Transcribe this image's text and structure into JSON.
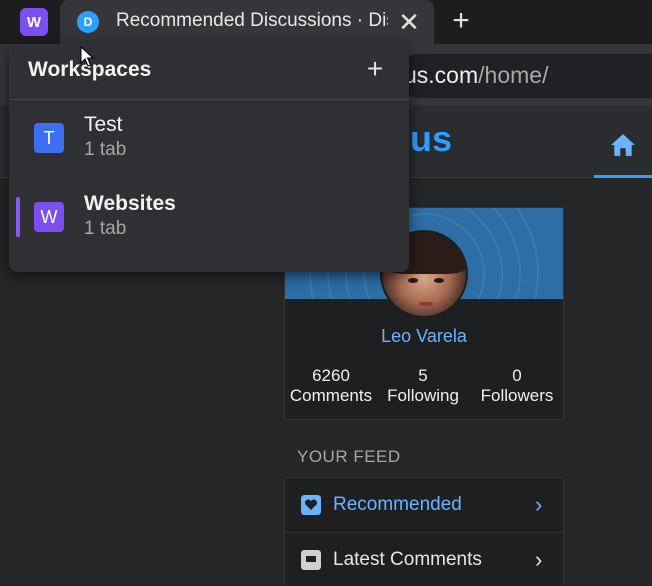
{
  "tabstrip": {
    "workspace_button_label": "W",
    "active_tab": {
      "favicon_letter": "D",
      "title": "Recommended Discussions · Disqus"
    },
    "close_glyph": "✕",
    "new_tab_glyph": "+"
  },
  "address_bar": {
    "host": "us.com",
    "path": "/home/"
  },
  "site": {
    "logo_fragment": "us"
  },
  "workspaces_popup": {
    "title": "Workspaces",
    "add_glyph": "+",
    "items": [
      {
        "badge": "T",
        "name": "Test",
        "subtitle": "1 tab",
        "color": "#3d6ff2",
        "active": false
      },
      {
        "badge": "W",
        "name": "Websites",
        "subtitle": "1 tab",
        "color": "#7c4ff0",
        "active": true
      }
    ]
  },
  "profile": {
    "name": "Leo Varela",
    "stats": [
      {
        "value": "6260",
        "label": "Comments"
      },
      {
        "value": "5",
        "label": "Following"
      },
      {
        "value": "0",
        "label": "Followers"
      }
    ]
  },
  "feed": {
    "heading": "YOUR FEED",
    "items": [
      {
        "label": "Recommended",
        "icon": "heart-icon",
        "chevron": "›"
      },
      {
        "label": "Latest Comments",
        "icon": "comment-icon",
        "chevron": "›"
      }
    ]
  },
  "colors": {
    "accent": "#2e9fff",
    "link": "#6cb2ff",
    "workspace_purple": "#7c4ff0"
  }
}
